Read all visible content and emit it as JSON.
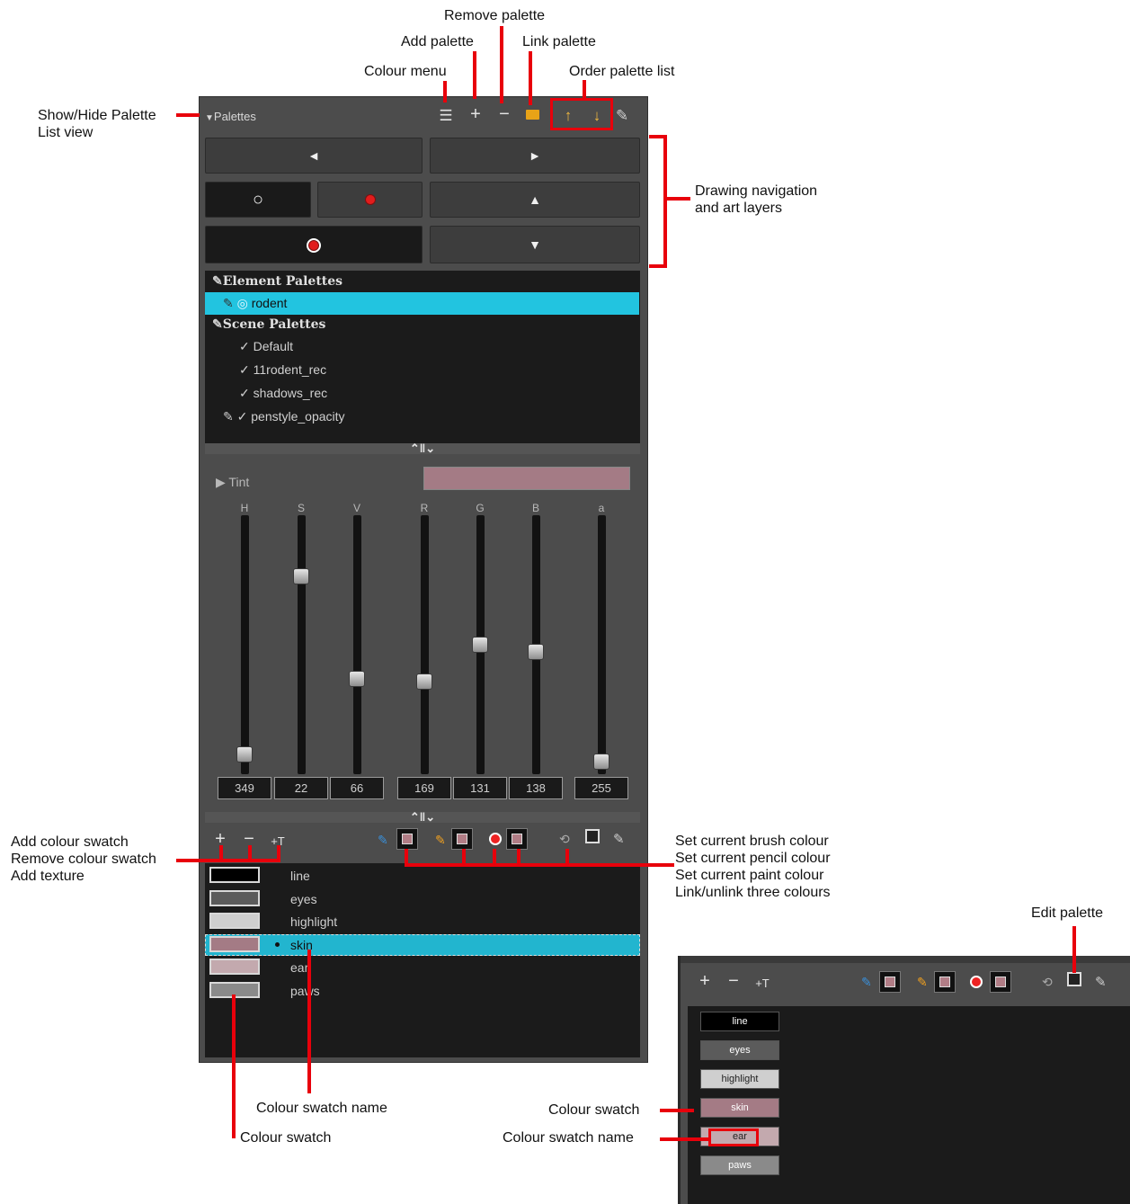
{
  "annotations": {
    "remove_palette": "Remove palette",
    "add_palette": "Add palette",
    "link_palette": "Link palette",
    "colour_menu": "Colour menu",
    "order_palette_list": "Order palette list",
    "show_hide_line1": "Show/Hide Palette",
    "show_hide_line2": "List view",
    "drawing_nav_line1": "Drawing navigation",
    "drawing_nav_line2": "and art layers",
    "add_colour_swatch": "Add colour swatch",
    "remove_colour_swatch": "Remove colour swatch",
    "add_texture": "Add texture",
    "set_brush": "Set current brush colour",
    "set_pencil": "Set current pencil colour",
    "set_paint": "Set current paint colour",
    "link_unlink": "Link/unlink three colours",
    "edit_palette": "Edit palette",
    "colour_swatch_name": "Colour swatch name",
    "colour_swatch": "Colour swatch",
    "inset_colour_swatch": "Colour swatch",
    "inset_colour_swatch_name": "Colour swatch name"
  },
  "panel": {
    "title": "Palettes",
    "icons": {
      "menu": "☰",
      "add": "+",
      "remove": "−",
      "link": "■",
      "up": "↑",
      "down": "↓",
      "edit": "✎"
    },
    "nav": {
      "prev": "◄",
      "next": "►",
      "up": "▲",
      "down": "▼",
      "circle": "○"
    }
  },
  "palette_list": {
    "element_header": "Element Palettes",
    "element_items": [
      "rodent"
    ],
    "scene_header": "Scene Palettes",
    "scene_items": [
      "Default",
      "11rodent_rec",
      "shadows_rec",
      "penstyle_opacity"
    ],
    "selected": "rodent"
  },
  "splitter_glyph": "⌃‖⌄",
  "colour_editor": {
    "tint_label": "Tint",
    "tint_arrow": "▶",
    "tint_color": "#a47b85",
    "channels": [
      {
        "label": "H",
        "value": "349",
        "level": 0.05
      },
      {
        "label": "S",
        "value": "22",
        "level": 0.78
      },
      {
        "label": "V",
        "value": "66",
        "level": 0.36
      },
      {
        "label": "R",
        "value": "169",
        "level": 0.35
      },
      {
        "label": "G",
        "value": "131",
        "level": 0.5
      },
      {
        "label": "B",
        "value": "138",
        "level": 0.47
      },
      {
        "label": "a",
        "value": "255",
        "level": 0.02
      }
    ]
  },
  "swatch_toolbar": {
    "add": "+",
    "remove": "−",
    "texture": "+T"
  },
  "swatches": [
    {
      "name": "line",
      "color": "#000000"
    },
    {
      "name": "eyes",
      "color": "#5b5b5b"
    },
    {
      "name": "highlight",
      "color": "#cfcfcf"
    },
    {
      "name": "skin",
      "color": "#a47b85",
      "selected": true
    },
    {
      "name": "ear",
      "color": "#c3a9ae"
    },
    {
      "name": "paws",
      "color": "#8a8a8a"
    }
  ],
  "inset": {
    "swatches": [
      {
        "name": "line",
        "color": "#000000",
        "text": "#ffffff"
      },
      {
        "name": "eyes",
        "color": "#5b5b5b",
        "text": "#ffffff"
      },
      {
        "name": "highlight",
        "color": "#cfcfcf",
        "text": "#222222"
      },
      {
        "name": "skin",
        "color": "#a47b85",
        "text": "#ffffff"
      },
      {
        "name": "ear",
        "color": "#c3a9ae",
        "text": "#222222"
      },
      {
        "name": "paws",
        "color": "#8a8a8a",
        "text": "#ffffff"
      }
    ]
  }
}
